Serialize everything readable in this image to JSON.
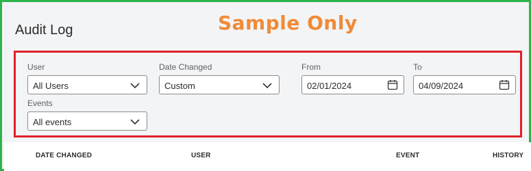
{
  "page": {
    "title": "Audit Log",
    "watermark": "Sample Only"
  },
  "filters": {
    "user": {
      "label": "User",
      "value": "All Users"
    },
    "date_changed": {
      "label": "Date Changed",
      "value": "Custom"
    },
    "from": {
      "label": "From",
      "value": "02/01/2024"
    },
    "to": {
      "label": "To",
      "value": "04/09/2024"
    },
    "events": {
      "label": "Events",
      "value": "All events"
    }
  },
  "table": {
    "columns": [
      "DATE CHANGED",
      "USER",
      "EVENT",
      "HISTORY"
    ]
  },
  "colors": {
    "frame_border": "#2db34a",
    "highlight_border": "#e0202a",
    "watermark": "#f08a37"
  },
  "icons": {
    "dropdown": "chevron-down-icon",
    "date": "calendar-icon"
  }
}
